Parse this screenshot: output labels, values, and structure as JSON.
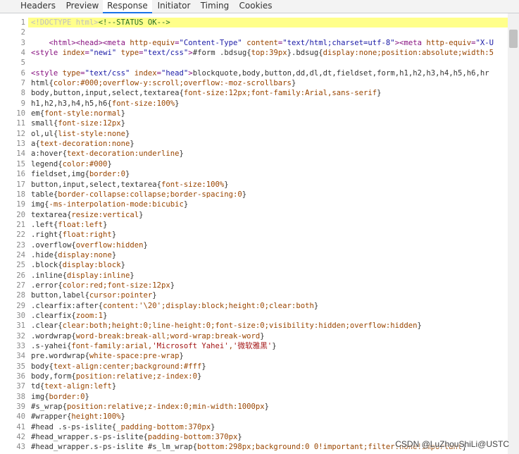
{
  "tabs": [
    {
      "label": "Headers",
      "active": false
    },
    {
      "label": "Preview",
      "active": false
    },
    {
      "label": "Response",
      "active": true
    },
    {
      "label": "Initiator",
      "active": false
    },
    {
      "label": "Timing",
      "active": false
    },
    {
      "label": "Cookies",
      "active": false
    }
  ],
  "lines": [
    {
      "n": "1",
      "hl": true,
      "parts": [
        [
          "t-doc",
          "<!DOCTYPE html>"
        ],
        [
          "t-comment",
          "<!--STATUS OK-->"
        ]
      ]
    },
    {
      "n": "2",
      "parts": []
    },
    {
      "n": "3",
      "parts": [
        [
          "",
          "    "
        ],
        [
          "t-tag",
          "<html><head><meta "
        ],
        [
          "t-attr",
          "http-equiv"
        ],
        [
          "t-tag",
          "="
        ],
        [
          "t-val",
          "\"Content-Type\""
        ],
        [
          "t-tag",
          " "
        ],
        [
          "t-attr",
          "content"
        ],
        [
          "t-tag",
          "="
        ],
        [
          "t-val",
          "\"text/html;charset=utf-8\""
        ],
        [
          "t-tag",
          "><meta "
        ],
        [
          "t-attr",
          "http-equiv"
        ],
        [
          "t-tag",
          "="
        ],
        [
          "t-val",
          "\"X-U"
        ]
      ]
    },
    {
      "n": "4",
      "parts": [
        [
          "t-tag",
          "<style "
        ],
        [
          "t-attr",
          "index"
        ],
        [
          "t-tag",
          "="
        ],
        [
          "t-val",
          "\"newi\""
        ],
        [
          "t-tag",
          " "
        ],
        [
          "t-attr",
          "type"
        ],
        [
          "t-tag",
          "="
        ],
        [
          "t-val",
          "\"text/css\""
        ],
        [
          "t-tag",
          ">"
        ],
        [
          "",
          "#form .bdsug{"
        ],
        [
          "t-prop",
          "top:39px"
        ],
        [
          "",
          "}.bdsug{"
        ],
        [
          "t-prop",
          "display:none;position:absolute;width:5"
        ]
      ]
    },
    {
      "n": "5",
      "parts": []
    },
    {
      "n": "6",
      "parts": [
        [
          "t-tag",
          "<style "
        ],
        [
          "t-attr",
          "type"
        ],
        [
          "t-tag",
          "="
        ],
        [
          "t-val",
          "\"text/css\""
        ],
        [
          "t-tag",
          " "
        ],
        [
          "t-attr",
          "index"
        ],
        [
          "t-tag",
          "="
        ],
        [
          "t-val",
          "\"head\""
        ],
        [
          "t-tag",
          ">"
        ],
        [
          "",
          "blockquote,body,button,dd,dl,dt,fieldset,form,h1,h2,h3,h4,h5,h6,hr"
        ]
      ]
    },
    {
      "n": "7",
      "parts": [
        [
          "",
          "html{"
        ],
        [
          "t-prop",
          "color:#000;overflow-y:scroll;overflow:-moz-scrollbars"
        ],
        [
          "",
          "}"
        ]
      ]
    },
    {
      "n": "8",
      "parts": [
        [
          "",
          "body,button,input,select,textarea{"
        ],
        [
          "t-prop",
          "font-size:12px;font-family:Arial,sans-serif"
        ],
        [
          "",
          "}"
        ]
      ]
    },
    {
      "n": "9",
      "parts": [
        [
          "",
          "h1,h2,h3,h4,h5,h6{"
        ],
        [
          "t-prop",
          "font-size:100%"
        ],
        [
          "",
          "}"
        ]
      ]
    },
    {
      "n": "10",
      "parts": [
        [
          "",
          "em{"
        ],
        [
          "t-prop",
          "font-style:normal"
        ],
        [
          "",
          "}"
        ]
      ]
    },
    {
      "n": "11",
      "parts": [
        [
          "",
          "small{"
        ],
        [
          "t-prop",
          "font-size:12px"
        ],
        [
          "",
          "}"
        ]
      ]
    },
    {
      "n": "12",
      "parts": [
        [
          "",
          "ol,ul{"
        ],
        [
          "t-prop",
          "list-style:none"
        ],
        [
          "",
          "}"
        ]
      ]
    },
    {
      "n": "13",
      "parts": [
        [
          "",
          "a{"
        ],
        [
          "t-prop",
          "text-decoration:none"
        ],
        [
          "",
          "}"
        ]
      ]
    },
    {
      "n": "14",
      "parts": [
        [
          "",
          "a:hover{"
        ],
        [
          "t-prop",
          "text-decoration:underline"
        ],
        [
          "",
          "}"
        ]
      ]
    },
    {
      "n": "15",
      "parts": [
        [
          "",
          "legend{"
        ],
        [
          "t-prop",
          "color:#000"
        ],
        [
          "",
          "}"
        ]
      ]
    },
    {
      "n": "16",
      "parts": [
        [
          "",
          "fieldset,img{"
        ],
        [
          "t-prop",
          "border:0"
        ],
        [
          "",
          "}"
        ]
      ]
    },
    {
      "n": "17",
      "parts": [
        [
          "",
          "button,input,select,textarea{"
        ],
        [
          "t-prop",
          "font-size:100%"
        ],
        [
          "",
          "}"
        ]
      ]
    },
    {
      "n": "18",
      "parts": [
        [
          "",
          "table{"
        ],
        [
          "t-prop",
          "border-collapse:collapse;border-spacing:0"
        ],
        [
          "",
          "}"
        ]
      ]
    },
    {
      "n": "19",
      "parts": [
        [
          "",
          "img{"
        ],
        [
          "t-prop",
          "-ms-interpolation-mode:bicubic"
        ],
        [
          "",
          "}"
        ]
      ]
    },
    {
      "n": "20",
      "parts": [
        [
          "",
          "textarea{"
        ],
        [
          "t-prop",
          "resize:vertical"
        ],
        [
          "",
          "}"
        ]
      ]
    },
    {
      "n": "21",
      "parts": [
        [
          "",
          ".left{"
        ],
        [
          "t-prop",
          "float:left"
        ],
        [
          "",
          "}"
        ]
      ]
    },
    {
      "n": "22",
      "parts": [
        [
          "",
          ".right{"
        ],
        [
          "t-prop",
          "float:right"
        ],
        [
          "",
          "}"
        ]
      ]
    },
    {
      "n": "23",
      "parts": [
        [
          "",
          ".overflow{"
        ],
        [
          "t-prop",
          "overflow:hidden"
        ],
        [
          "",
          "}"
        ]
      ]
    },
    {
      "n": "24",
      "parts": [
        [
          "",
          ".hide{"
        ],
        [
          "t-prop",
          "display:none"
        ],
        [
          "",
          "}"
        ]
      ]
    },
    {
      "n": "25",
      "parts": [
        [
          "",
          ".block{"
        ],
        [
          "t-prop",
          "display:block"
        ],
        [
          "",
          "}"
        ]
      ]
    },
    {
      "n": "26",
      "parts": [
        [
          "",
          ".inline{"
        ],
        [
          "t-prop",
          "display:inline"
        ],
        [
          "",
          "}"
        ]
      ]
    },
    {
      "n": "27",
      "parts": [
        [
          "",
          ".error{"
        ],
        [
          "t-prop",
          "color:red;font-size:12px"
        ],
        [
          "",
          "}"
        ]
      ]
    },
    {
      "n": "28",
      "parts": [
        [
          "",
          "button,label{"
        ],
        [
          "t-prop",
          "cursor:pointer"
        ],
        [
          "",
          "}"
        ]
      ]
    },
    {
      "n": "29",
      "parts": [
        [
          "",
          ".clearfix:after{"
        ],
        [
          "t-prop",
          "content:'\\20';display:block;height:0;clear:both"
        ],
        [
          "",
          "}"
        ]
      ]
    },
    {
      "n": "30",
      "parts": [
        [
          "",
          ".clearfix{"
        ],
        [
          "t-prop",
          "zoom:1"
        ],
        [
          "",
          "}"
        ]
      ]
    },
    {
      "n": "31",
      "parts": [
        [
          "",
          ".clear{"
        ],
        [
          "t-prop",
          "clear:both;height:0;line-height:0;font-size:0;visibility:hidden;overflow:hidden"
        ],
        [
          "",
          "}"
        ]
      ]
    },
    {
      "n": "32",
      "parts": [
        [
          "",
          ".wordwrap{"
        ],
        [
          "t-prop",
          "word-break:break-all;word-wrap:break-word"
        ],
        [
          "",
          "}"
        ]
      ]
    },
    {
      "n": "33",
      "parts": [
        [
          "",
          ".s-yahei{"
        ],
        [
          "t-prop",
          "font-family:arial,"
        ],
        [
          "t-str",
          "'Microsoft Yahei'"
        ],
        [
          "t-prop",
          ","
        ],
        [
          "t-str",
          "'微软雅黑'"
        ],
        [
          "",
          "}"
        ]
      ]
    },
    {
      "n": "34",
      "parts": [
        [
          "",
          "pre.wordwrap{"
        ],
        [
          "t-prop",
          "white-space:pre-wrap"
        ],
        [
          "",
          "}"
        ]
      ]
    },
    {
      "n": "35",
      "parts": [
        [
          "",
          "body{"
        ],
        [
          "t-prop",
          "text-align:center;background:#fff"
        ],
        [
          "",
          "}"
        ]
      ]
    },
    {
      "n": "36",
      "parts": [
        [
          "",
          "body,form{"
        ],
        [
          "t-prop",
          "position:relative;z-index:0"
        ],
        [
          "",
          "}"
        ]
      ]
    },
    {
      "n": "37",
      "parts": [
        [
          "",
          "td{"
        ],
        [
          "t-prop",
          "text-align:left"
        ],
        [
          "",
          "}"
        ]
      ]
    },
    {
      "n": "38",
      "parts": [
        [
          "",
          "img{"
        ],
        [
          "t-prop",
          "border:0"
        ],
        [
          "",
          "}"
        ]
      ]
    },
    {
      "n": "39",
      "parts": [
        [
          "",
          "#s_wrap{"
        ],
        [
          "t-prop",
          "position:relative;z-index:0;min-width:1000px"
        ],
        [
          "",
          "}"
        ]
      ]
    },
    {
      "n": "40",
      "parts": [
        [
          "",
          "#wrapper{"
        ],
        [
          "t-prop",
          "height:100%"
        ],
        [
          "",
          "}"
        ]
      ]
    },
    {
      "n": "41",
      "parts": [
        [
          "",
          "#head .s-ps-islite{"
        ],
        [
          "t-prop",
          "_padding-bottom:370px"
        ],
        [
          "",
          "}"
        ]
      ]
    },
    {
      "n": "42",
      "parts": [
        [
          "",
          "#head_wrapper.s-ps-islite{"
        ],
        [
          "t-prop",
          "padding-bottom:370px"
        ],
        [
          "",
          "}"
        ]
      ]
    },
    {
      "n": "43",
      "parts": [
        [
          "",
          "#head_wrapper.s-ps-islite #s_lm_wrap{"
        ],
        [
          "t-prop",
          "bottom:298px;background:0 0!important;filter:none!important"
        ],
        [
          "",
          "}"
        ]
      ]
    }
  ],
  "watermark": "CSDN @LuZhouShiLi@USTC"
}
